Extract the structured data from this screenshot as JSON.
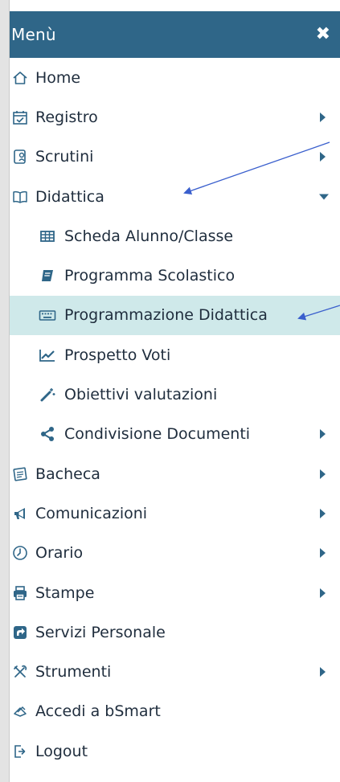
{
  "menu": {
    "title": "Menù",
    "close_label": "✖",
    "items": [
      {
        "label": "Home",
        "icon": "home-icon"
      },
      {
        "label": "Registro",
        "icon": "calendar-icon"
      },
      {
        "label": "Scrutini",
        "icon": "scrutini-icon"
      },
      {
        "label": "Didattica",
        "icon": "book-open-icon"
      },
      {
        "label": "Scheda Alunno/Classe",
        "icon": "table-icon"
      },
      {
        "label": "Programma Scolastico",
        "icon": "book-icon"
      },
      {
        "label": "Programmazione Didattica",
        "icon": "keyboard-icon"
      },
      {
        "label": "Prospetto Voti",
        "icon": "line-chart-icon"
      },
      {
        "label": "Obiettivi valutazioni",
        "icon": "magic-wand-icon"
      },
      {
        "label": "Condivisione Documenti",
        "icon": "share-icon"
      },
      {
        "label": "Bacheca",
        "icon": "bulletin-icon"
      },
      {
        "label": "Comunicazioni",
        "icon": "bullhorn-icon"
      },
      {
        "label": "Orario",
        "icon": "clock-icon"
      },
      {
        "label": "Stampe",
        "icon": "printer-icon"
      },
      {
        "label": "Servizi Personale",
        "icon": "external-link-icon"
      },
      {
        "label": "Strumenti",
        "icon": "tools-icon"
      },
      {
        "label": "Accedi a bSmart",
        "icon": "bsmart-icon"
      },
      {
        "label": "Logout",
        "icon": "logout-icon"
      }
    ],
    "active_item": "Programmazione Didattica"
  },
  "colors": {
    "header_bg": "#2f6688",
    "accent": "#2f6688",
    "active_bg": "#cfe9ea",
    "annotation_arrow": "#3a5fcd"
  }
}
